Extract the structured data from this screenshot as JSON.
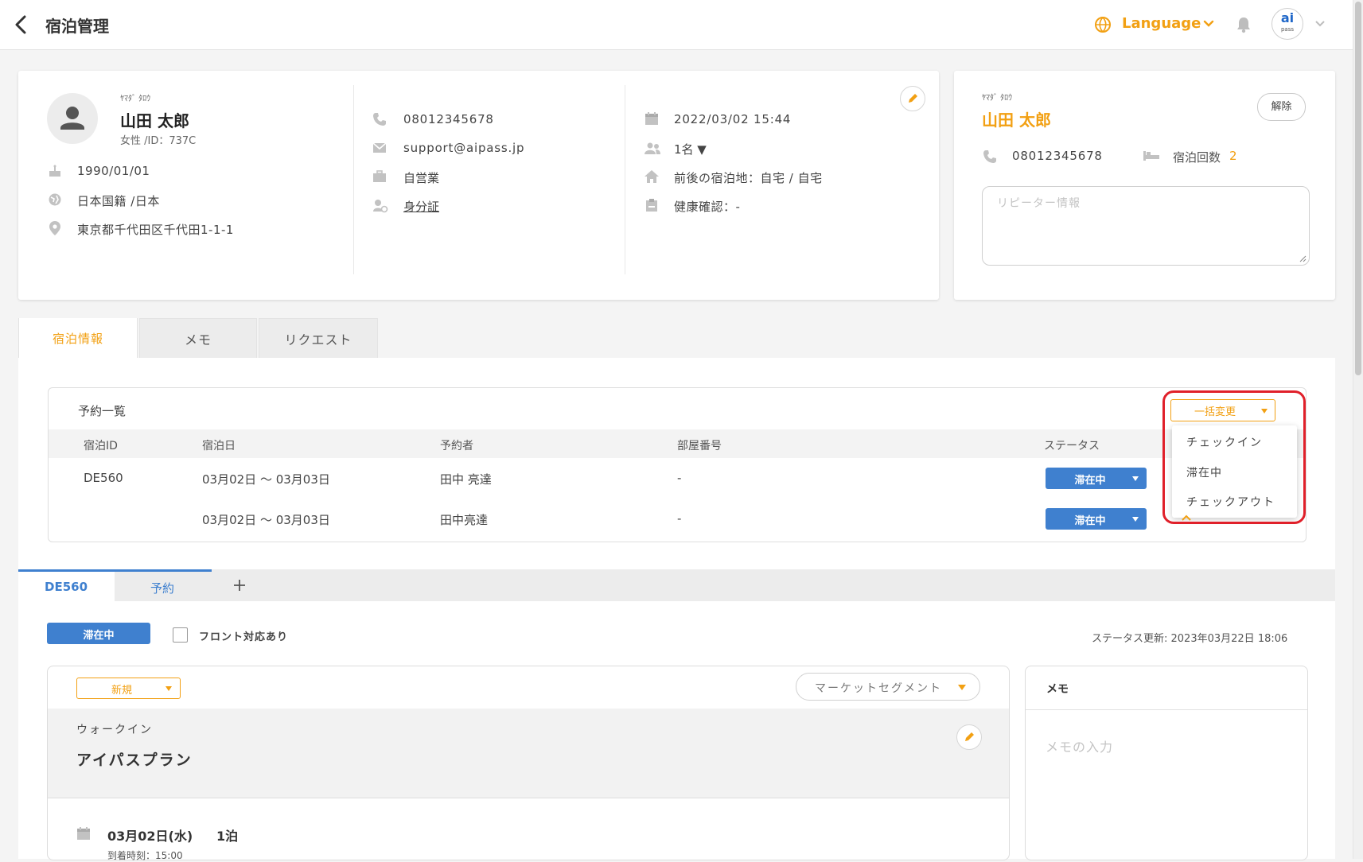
{
  "header": {
    "title": "宿泊管理",
    "language_label": "Language",
    "avatar_text": "ai",
    "avatar_sub": "pass"
  },
  "guest": {
    "furigana": "ﾔﾏﾀﾞ ﾀﾛｳ",
    "name": "山田 太郎",
    "gender_id": "女性 /ID：737C",
    "birthday": "1990/01/01",
    "nationality": "日本国籍 /日本",
    "address": "東京都千代田区千代田1-1-1",
    "phone": "08012345678",
    "email": "support@aipass.jp",
    "occupation": "自営業",
    "id_document": "身分証",
    "checkin_datetime": "2022/03/02 15:44",
    "guests_count": "1名 ▼",
    "prev_next_stay": "前後の宿泊地：自宅 / 自宅",
    "health_check": "健康確認：-"
  },
  "repeater": {
    "furigana": "ﾔﾏﾀﾞ ﾀﾛｳ",
    "name": "山田 太郎",
    "release_label": "解除",
    "phone": "08012345678",
    "stay_count_label": "宿泊回数",
    "stay_count": "2",
    "textarea_placeholder": "リピーター情報"
  },
  "tabs": [
    {
      "label": "宿泊情報"
    },
    {
      "label": "メモ"
    },
    {
      "label": "リクエスト"
    }
  ],
  "reservations": {
    "title": "予約一覧",
    "bulk_change_label": "一括変更",
    "columns": [
      "宿泊ID",
      "宿泊日",
      "予約者",
      "部屋番号",
      "ステータス"
    ],
    "rows": [
      {
        "id": "DE560",
        "dates": "03月02日 ～ 03月03日",
        "booker": "田中 亮達",
        "room": "-",
        "status": "滞在中"
      },
      {
        "id": "",
        "dates": "03月02日 ～ 03月03日",
        "booker": "田中亮達",
        "room": "-",
        "status": "滞在中"
      }
    ],
    "dropdown_options": [
      "チェックイン",
      "滞在中",
      "チェックアウト"
    ]
  },
  "sub_tabs": [
    {
      "label": "DE560"
    },
    {
      "label": "予約"
    }
  ],
  "detail": {
    "status": "滞在中",
    "front_label": "フロント対応あり",
    "status_updated": "ステータス更新: 2023年03月22日 18:06",
    "new_label": "新規",
    "market_segment_label": "マーケットセグメント",
    "channel": "ウォークイン",
    "plan": "アイパスプラン",
    "checkin_date": "03月02日(水)",
    "nights": "1泊",
    "arrival_time": "到着時刻：15:00"
  },
  "memo": {
    "title": "メモ",
    "placeholder": "メモの入力"
  },
  "colors": {
    "accent": "#f2a013",
    "status_blue": "#3f80cf",
    "highlight_red": "#e0202a"
  }
}
